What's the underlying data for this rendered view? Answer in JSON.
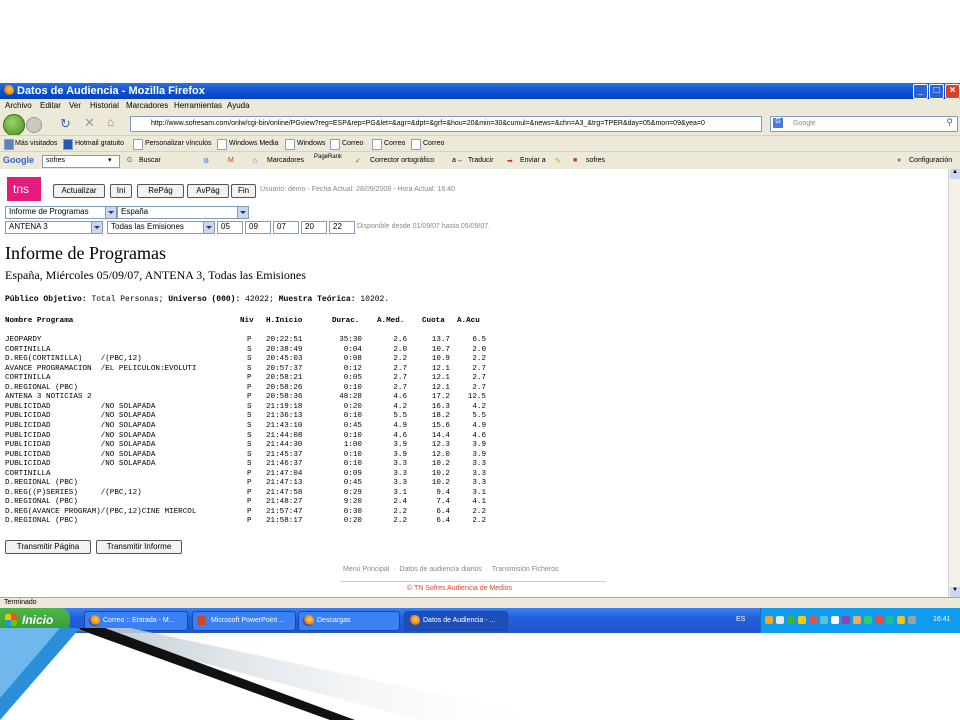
{
  "window": {
    "title": "Datos de Audiencia - Mozilla Firefox",
    "menu": [
      "Archivo",
      "Editar",
      "Ver",
      "Historial",
      "Marcadores",
      "Herramientas",
      "Ayuda"
    ],
    "url": "http://www.sofresam.com/onlw/cgi-bin/online/PGview?reg=ESP&rep=PG&let=&agr=&dpt=&grf=&hou=20&min=30&cumul=&news=&chn=A3_&trg=TPER&day=05&mon=09&yea=0",
    "search_placeholder": "Google",
    "bookmarks": [
      "Más visitados",
      "Hotmail gratuito",
      "Personalizar vínculos",
      "Windows Media",
      "Windows",
      "Correo",
      "Correo",
      "Correo"
    ],
    "google_toolbar": {
      "label": "Google",
      "query": "sofres",
      "buscar": "Buscar",
      "marcadores": "Marcadores",
      "pagerank": "PageRank",
      "corrector": "Corrector ortográfico",
      "traducir": "Traducir",
      "enviar": "Enviar a",
      "sofres": "sofres",
      "config": "Configuración"
    },
    "status": "Terminado"
  },
  "taskbar": {
    "start": "Inicio",
    "tasks": [
      "Correo :: Entrada - M...",
      "Microsoft PowerPoint ...",
      "Descargas",
      "Datos de Audiencia - ..."
    ],
    "lang": "ES",
    "clock": "16:41"
  },
  "page": {
    "logo": "tns",
    "buttons": [
      "Actualizar",
      "Ini",
      "RePág",
      "AvPág",
      "Fin"
    ],
    "user_info": "Usuario: demo - Fecha Actual: 28/09/2008 - Hora Actual: 16:40",
    "report_select": "Informe de Programas",
    "region_select": "España",
    "channel_select": "ANTENA 3",
    "emissions_select": "Todas las Emisiones",
    "fields": [
      "05",
      "09",
      "07",
      "20",
      "22"
    ],
    "available": "Disponible desde 01/09/07 hasta 05/09/07.",
    "title": "Informe de Programas",
    "subtitle": "España, Miércoles 05/09/07, ANTENA 3, Todas las Emisiones",
    "target_line": {
      "k1": "Público Objetivo:",
      "v1": "Total Personas;",
      "k2": "Universo (000):",
      "v2": "42022;",
      "k3": "Muestra Teórica:",
      "v3": "10202."
    },
    "table": {
      "headers": [
        "Nombre Programa",
        "Niv",
        "H.Inicio",
        "Durac.",
        "A.Med.",
        "Cuota",
        "A.Acu"
      ],
      "rows": [
        [
          "JEOPARDY",
          "P",
          "20:22:51",
          "35:30",
          "2.6",
          "13.7",
          "6.5"
        ],
        [
          "CORTINILLA",
          "S",
          "20:38:49",
          "0:04",
          "2.0",
          "10.7",
          "2.0"
        ],
        [
          "D.REG(CORTINILLA)    /(PBC,12)",
          "S",
          "20:45:03",
          "0:08",
          "2.2",
          "10.9",
          "2.2"
        ],
        [
          "AVANCE PROGRAMACION  /EL PELICULON:EVOLUTI",
          "S",
          "20:57:37",
          "0:12",
          "2.7",
          "12.1",
          "2.7"
        ],
        [
          "CORTINILLA",
          "P",
          "20:58:21",
          "0:05",
          "2.7",
          "12.1",
          "2.7"
        ],
        [
          "D.REGIONAL (PBC)",
          "P",
          "20:58:26",
          "0:10",
          "2.7",
          "12.1",
          "2.7"
        ],
        [
          "ANTENA 3 NOTICIAS 2",
          "P",
          "20:58:36",
          "48:28",
          "4.6",
          "17.2",
          "12.5"
        ],
        [
          "PUBLICIDAD           /NO SOLAPADA",
          "S",
          "21:19:18",
          "0:20",
          "4.2",
          "16.3",
          "4.2"
        ],
        [
          "PUBLICIDAD           /NO SOLAPADA",
          "S",
          "21:36:13",
          "0:10",
          "5.5",
          "18.2",
          "5.5"
        ],
        [
          "PUBLICIDAD           /NO SOLAPADA",
          "S",
          "21:43:10",
          "0:45",
          "4.9",
          "15.6",
          "4.9"
        ],
        [
          "PUBLICIDAD           /NO SOLAPADA",
          "S",
          "21:44:08",
          "0:10",
          "4.6",
          "14.4",
          "4.6"
        ],
        [
          "PUBLICIDAD           /NO SOLAPADA",
          "S",
          "21:44:30",
          "1:00",
          "3.9",
          "12.3",
          "3.9"
        ],
        [
          "PUBLICIDAD           /NO SOLAPADA",
          "S",
          "21:45:37",
          "0:10",
          "3.9",
          "12.0",
          "3.9"
        ],
        [
          "PUBLICIDAD           /NO SOLAPADA",
          "S",
          "21:46:37",
          "0:10",
          "3.3",
          "10.2",
          "3.3"
        ],
        [
          "CORTINILLA",
          "P",
          "21:47:04",
          "0:09",
          "3.3",
          "10.2",
          "3.3"
        ],
        [
          "D.REGIONAL (PBC)",
          "P",
          "21:47:13",
          "0:45",
          "3.3",
          "10.2",
          "3.3"
        ],
        [
          "D.REG((P)SERIES)     /(PBC,12)",
          "P",
          "21:47:58",
          "0:29",
          "3.1",
          "9.4",
          "3.1"
        ],
        [
          "D.REGIONAL (PBC)",
          "P",
          "21:48:27",
          "9:20",
          "2.4",
          "7.4",
          "4.1"
        ],
        [
          "D.REG(AVANCE PROGRAM)/(PBC,12)CINE MIERCOL",
          "P",
          "21:57:47",
          "0:30",
          "2.2",
          "6.4",
          "2.2"
        ],
        [
          "D.REGIONAL (PBC)",
          "P",
          "21:58:17",
          "0:20",
          "2.2",
          "6.4",
          "2.2"
        ]
      ]
    },
    "transmit_page": "Transmitir Página",
    "transmit_report": "Transmitir Informe",
    "footer_links": "Menú Principal  ·  Datos de audiencia diarios  ·  Transmisión Ficheros",
    "copyright": "© TN Sofres Audiencia de Medios"
  }
}
